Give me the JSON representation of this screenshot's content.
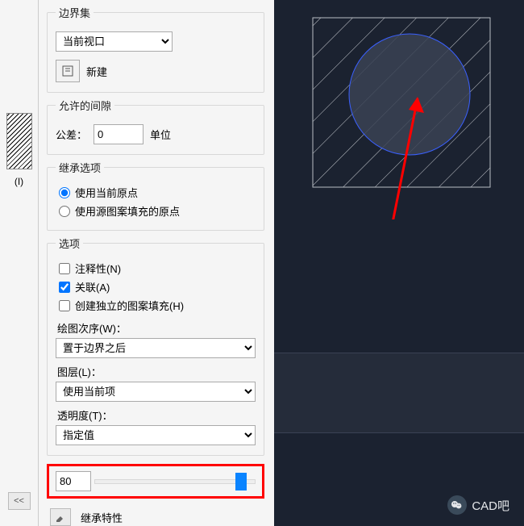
{
  "left": {
    "swatch_label": "(I)",
    "expand_label": "<<"
  },
  "boundary_set": {
    "legend": "边界集",
    "dropdown": "当前视口",
    "new_button": "新建"
  },
  "gap": {
    "legend": "允许的间隙",
    "tolerance_label": "公差：",
    "tolerance_value": "0",
    "units": "单位"
  },
  "inherit": {
    "legend": "继承选项",
    "opt_current": "使用当前原点",
    "opt_source": "使用源图案填充的原点"
  },
  "options": {
    "legend": "选项",
    "annotative": "注释性(N)",
    "associative": "关联(A)",
    "separate": "创建独立的图案填充(H)",
    "draw_order_label": "绘图次序(W)：",
    "draw_order_value": "置于边界之后",
    "layer_label": "图层(L)：",
    "layer_value": "使用当前项",
    "transparency_label": "透明度(T)：",
    "transparency_value": "指定值"
  },
  "slider": {
    "value": "80"
  },
  "footer": {
    "inherit_props": "继承特性"
  },
  "watermark": "CAD吧"
}
